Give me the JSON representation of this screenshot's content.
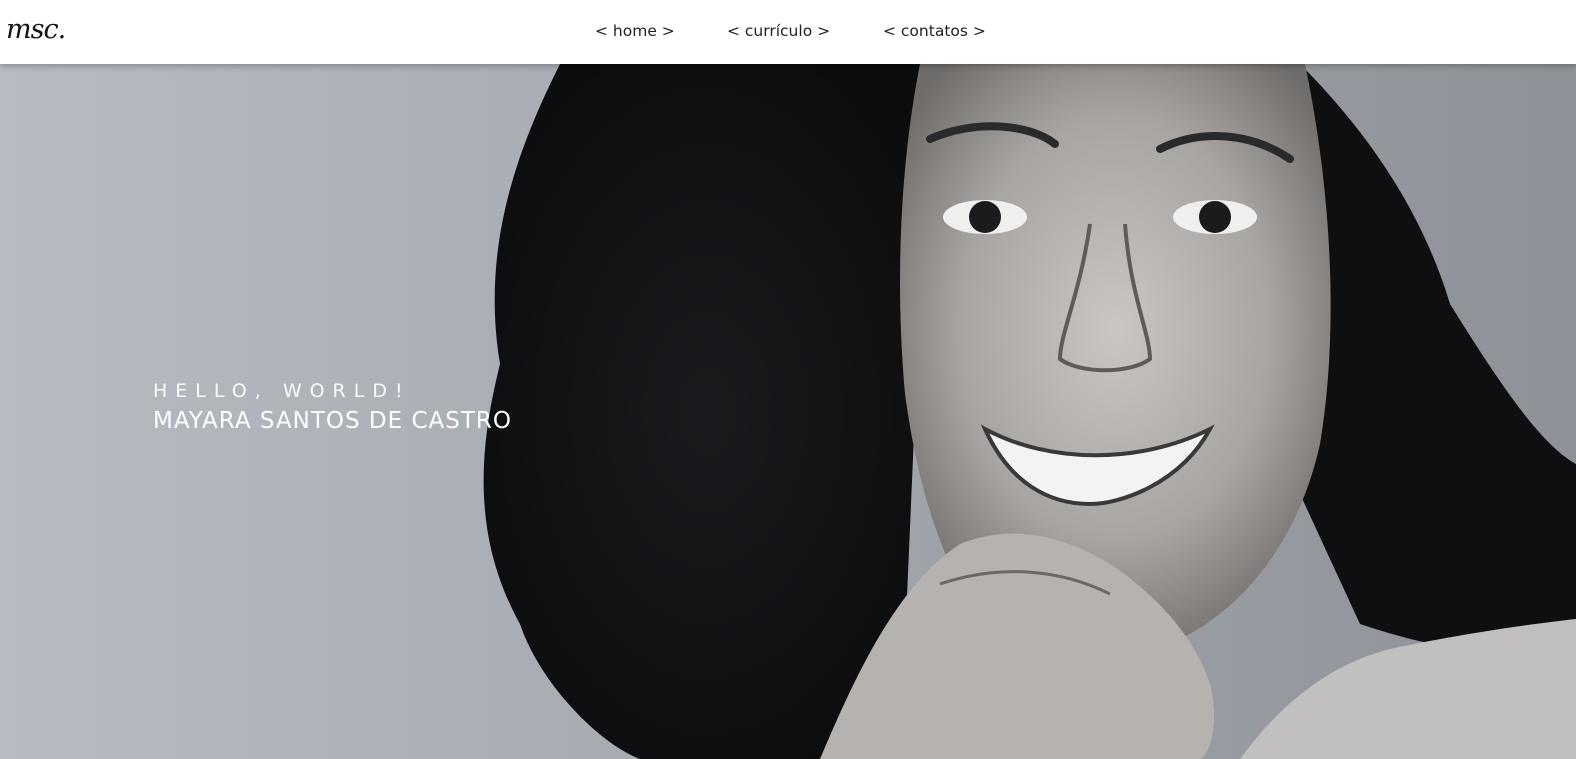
{
  "brand": {
    "logo_text": "msc."
  },
  "nav": {
    "items": [
      {
        "label": "< home >"
      },
      {
        "label": "< currículo >"
      },
      {
        "label": "< contatos >"
      }
    ]
  },
  "hero": {
    "greeting": "HELLO, WORLD!",
    "name": "MAYARA SANTOS DE CASTRO",
    "image": "black-and-white portrait photo"
  },
  "colors": {
    "header_bg": "#ffffff",
    "nav_text": "#222222",
    "hero_text": "#ffffff",
    "hero_bg": "#a9adb4"
  }
}
